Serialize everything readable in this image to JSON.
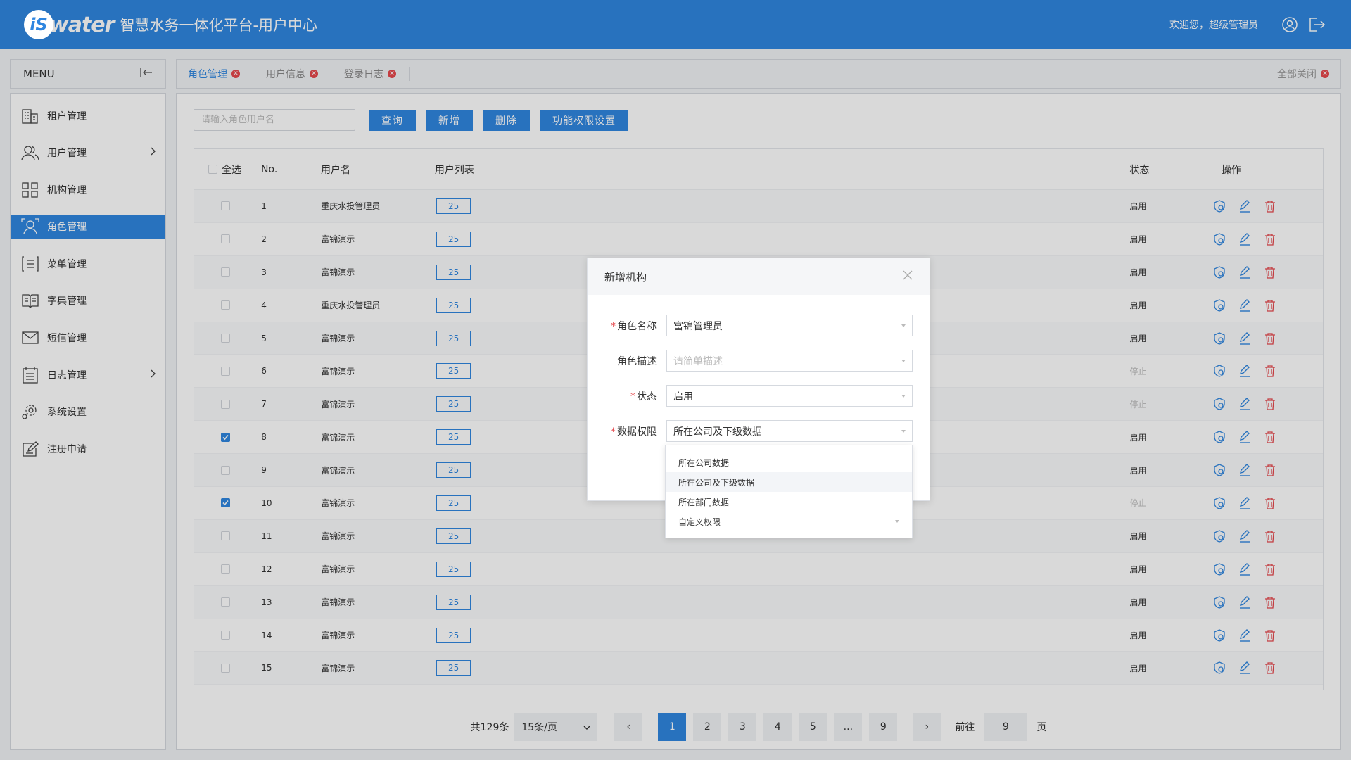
{
  "header": {
    "logo_mark": "iS",
    "logo_word": "water",
    "title": "智慧水务一体化平台-用户中心",
    "welcome": "欢迎您，超级管理员"
  },
  "sidebar": {
    "menu_label": "MENU",
    "items": [
      {
        "label": "租户管理",
        "icon": "building-icon",
        "has_arrow": false
      },
      {
        "label": "用户管理",
        "icon": "users-icon",
        "has_arrow": true
      },
      {
        "label": "机构管理",
        "icon": "org-icon",
        "has_arrow": false
      },
      {
        "label": "角色管理",
        "icon": "role-icon",
        "has_arrow": false,
        "active": true
      },
      {
        "label": "菜单管理",
        "icon": "menu-list-icon",
        "has_arrow": false
      },
      {
        "label": "字典管理",
        "icon": "book-icon",
        "has_arrow": false
      },
      {
        "label": "短信管理",
        "icon": "mail-icon",
        "has_arrow": false
      },
      {
        "label": "日志管理",
        "icon": "calendar-icon",
        "has_arrow": true
      },
      {
        "label": "系统设置",
        "icon": "gear-icon",
        "has_arrow": false
      },
      {
        "label": "注册申请",
        "icon": "edit-form-icon",
        "has_arrow": false
      }
    ]
  },
  "tabs": {
    "items": [
      {
        "label": "角色管理",
        "active": true
      },
      {
        "label": "用户信息",
        "active": false
      },
      {
        "label": "登录日志",
        "active": false
      }
    ],
    "close_all": "全部关闭"
  },
  "toolbar": {
    "search_placeholder": "请输入角色用户名",
    "query": "查询",
    "add": "新增",
    "delete": "删除",
    "permission": "功能权限设置"
  },
  "table": {
    "headers": {
      "select_all": "全选",
      "no": "No.",
      "name": "用户名",
      "list": "用户列表",
      "status": "状态",
      "ops": "操作"
    },
    "rows": [
      {
        "no": "1",
        "name": "重庆水投管理员",
        "count": "25",
        "status": "启用",
        "checked": false
      },
      {
        "no": "2",
        "name": "富锦演示",
        "count": "25",
        "status": "启用",
        "checked": false
      },
      {
        "no": "3",
        "name": "富锦演示",
        "count": "25",
        "status": "启用",
        "checked": false
      },
      {
        "no": "4",
        "name": "重庆水投管理员",
        "count": "25",
        "status": "启用",
        "checked": false
      },
      {
        "no": "5",
        "name": "富锦演示",
        "count": "25",
        "status": "启用",
        "checked": false
      },
      {
        "no": "6",
        "name": "富锦演示",
        "count": "25",
        "status": "停止",
        "checked": false
      },
      {
        "no": "7",
        "name": "富锦演示",
        "count": "25",
        "status": "停止",
        "checked": false
      },
      {
        "no": "8",
        "name": "富锦演示",
        "count": "25",
        "status": "启用",
        "checked": true
      },
      {
        "no": "9",
        "name": "富锦演示",
        "count": "25",
        "status": "启用",
        "checked": false
      },
      {
        "no": "10",
        "name": "富锦演示",
        "count": "25",
        "status": "停止",
        "checked": true
      },
      {
        "no": "11",
        "name": "富锦演示",
        "count": "25",
        "status": "启用",
        "checked": false
      },
      {
        "no": "12",
        "name": "富锦演示",
        "count": "25",
        "status": "启用",
        "checked": false
      },
      {
        "no": "13",
        "name": "富锦演示",
        "count": "25",
        "status": "启用",
        "checked": false
      },
      {
        "no": "14",
        "name": "富锦演示",
        "count": "25",
        "status": "启用",
        "checked": false
      },
      {
        "no": "15",
        "name": "富锦演示",
        "count": "25",
        "status": "启用",
        "checked": false
      }
    ]
  },
  "pager": {
    "total": "共129条",
    "page_size": "15条/页",
    "prev": "‹",
    "next": "›",
    "pages": [
      "1",
      "2",
      "3",
      "4",
      "5",
      "...",
      "9"
    ],
    "current": "1",
    "goto_label": "前往",
    "goto_value": "9",
    "goto_suffix": "页"
  },
  "modal": {
    "title": "新增机构",
    "fields": {
      "role_name_label": "角色名称",
      "role_name_value": "富锦管理员",
      "role_desc_label": "角色描述",
      "role_desc_placeholder": "请简单描述",
      "status_label": "状态",
      "status_value": "启用",
      "data_perm_label": "数据权限",
      "data_perm_value": "所在公司及下级数据"
    },
    "dropdown_options": [
      "所在公司数据",
      "所在公司及下级数据",
      "所在部门数据",
      "自定义权限"
    ]
  },
  "colors": {
    "primary": "#2f86e0",
    "danger": "#e5484d"
  }
}
